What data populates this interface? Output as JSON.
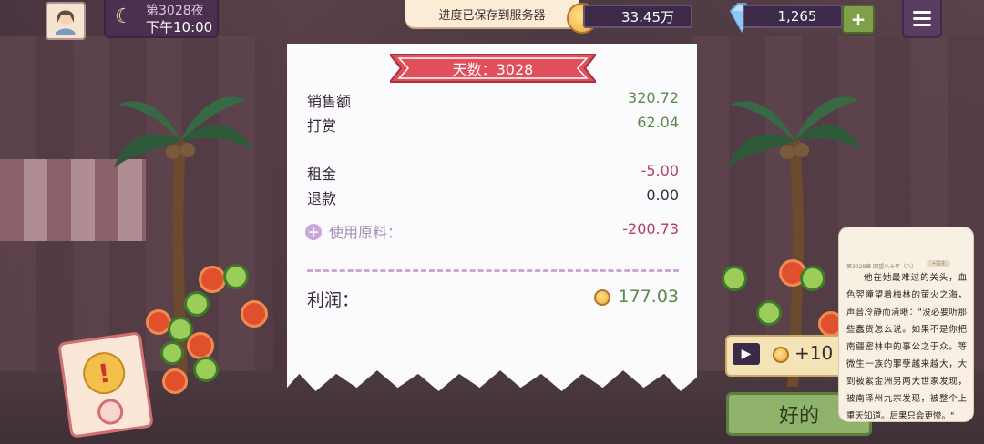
{
  "hud": {
    "day_label": "第3028夜",
    "time_label": "下午10:00",
    "toast": "进度已保存到服务器",
    "coins": "33.45万",
    "gems": "1,265",
    "add_label": "+"
  },
  "receipt": {
    "banner": "天数：3028",
    "rows": [
      {
        "label": "销售额",
        "value": "320.72"
      },
      {
        "label": "打赏",
        "value": "62.04"
      },
      {
        "label": "租金",
        "value": "-5.00"
      },
      {
        "label": "退款",
        "value": "0.00"
      }
    ],
    "ingredients_label": "使用原料：",
    "ingredients_value": "-200.73",
    "profit_label": "利润：",
    "profit_value": "177.03"
  },
  "alert": {
    "mark": "!"
  },
  "ad_reward": {
    "amount": "+10"
  },
  "ok_button": "好的",
  "text_panel": {
    "header": "第3028章 回望八十年（八）",
    "pill": "+关注",
    "body": "他在她最难过的关头，血色翌瞳望着梅林的萤火之海，声音冷静而清晰：\"没必要听那些蠢货怎么说。如果不是你把南疆密林中的事公之于众。等微生一族的罪孽越来越大，大到被紫金洲另两大世家发现，被南泽州九宗发现，被整个上重天知道。后果只会更惨。\""
  },
  "colors": {
    "positive": "#5a8a4a",
    "negative": "#b3405a",
    "banner": "#e0505c",
    "ok_button": "#8fb36a"
  }
}
